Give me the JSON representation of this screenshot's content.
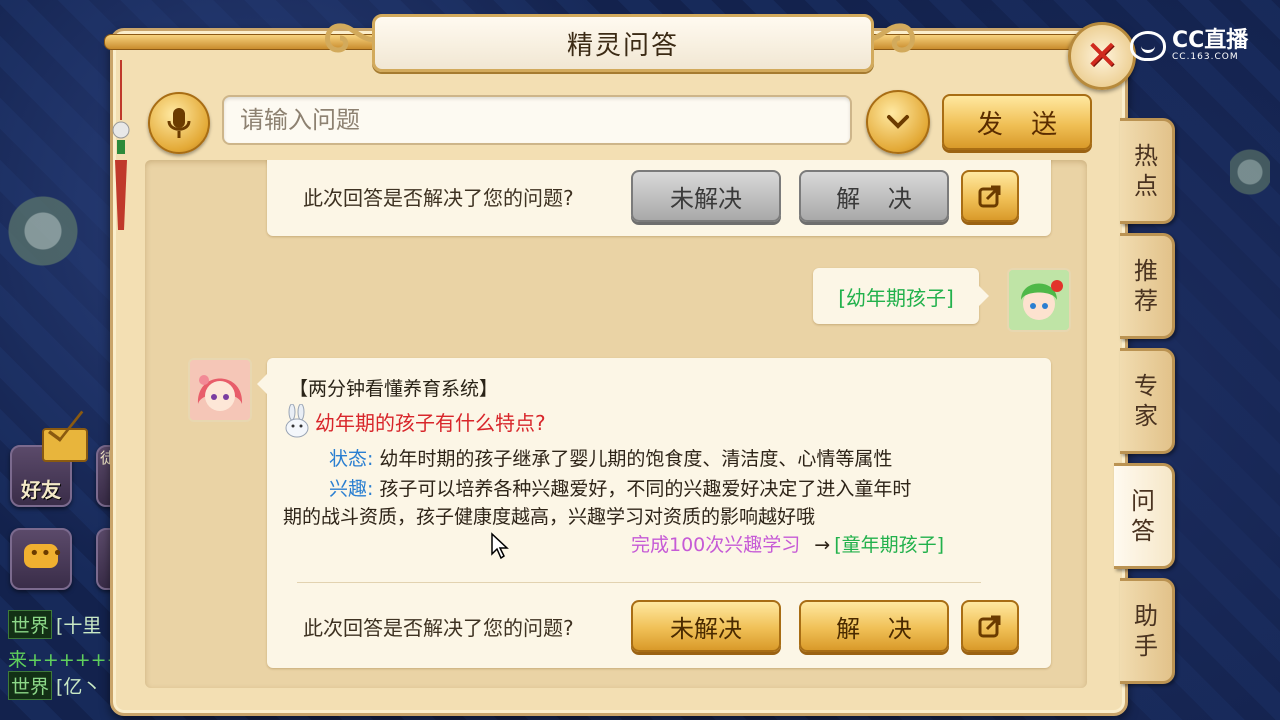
{
  "window": {
    "title": "精灵问答",
    "watermark_brand": "CC直播",
    "watermark_sub": "CC.163.COM"
  },
  "search": {
    "placeholder": "请输入问题",
    "send_label": "发 送"
  },
  "hud": {
    "friends_label": "好友",
    "partial_label": "徒",
    "world_rows": [
      {
        "tag": "世界",
        "text": "[十里"
      },
      {
        "tag": "",
        "text": "来++++++++"
      },
      {
        "tag": "世界",
        "text": "[亿丶"
      }
    ]
  },
  "chat": {
    "previous_feedback": {
      "question": "此次回答是否解决了您的问题?",
      "unsolved": "未解决",
      "solved": "解 决"
    },
    "user_message": "[幼年期孩子]",
    "answer": {
      "header": "【两分钟看懂养育系统】",
      "question": "幼年期的孩子有什么特点?",
      "status_key": "状态:",
      "status_text": "幼年时期的孩子继承了婴儿期的饱食度、清洁度、心情等属性",
      "interest_key": "兴趣:",
      "interest_text": "孩子可以培养各种兴趣爱好，不同的兴趣爱好决定了进入童年时",
      "interest_cont": "期的战斗资质，孩子健康度越高，兴趣学习对资质的影响越好哦",
      "req_condition": "完成100次兴趣学习",
      "req_arrow": "→",
      "req_result": "[童年期孩子]"
    },
    "feedback": {
      "question": "此次回答是否解决了您的问题?",
      "unsolved": "未解决",
      "solved": "解 决"
    }
  },
  "tabs": [
    {
      "label_top": "热",
      "label_bottom": "点",
      "active": false
    },
    {
      "label_top": "推",
      "label_bottom": "荐",
      "active": false
    },
    {
      "label_top": "专",
      "label_bottom": "家",
      "active": false
    },
    {
      "label_top": "问",
      "label_bottom": "答",
      "active": true
    },
    {
      "label_top": "助",
      "label_bottom": "手",
      "active": false
    }
  ],
  "colors": {
    "accent_gold": "#f0c056",
    "answer_question_red": "#d8262b",
    "key_blue": "#2a7fd1",
    "child_green": "#22b14c",
    "condition_purple": "#c65ad6",
    "close_red": "#d12a1e"
  },
  "icons": [
    "microphone-icon",
    "chevron-down-icon",
    "close-icon",
    "share-icon",
    "bunny-icon",
    "mail-icon",
    "chat-bubble-icon"
  ]
}
